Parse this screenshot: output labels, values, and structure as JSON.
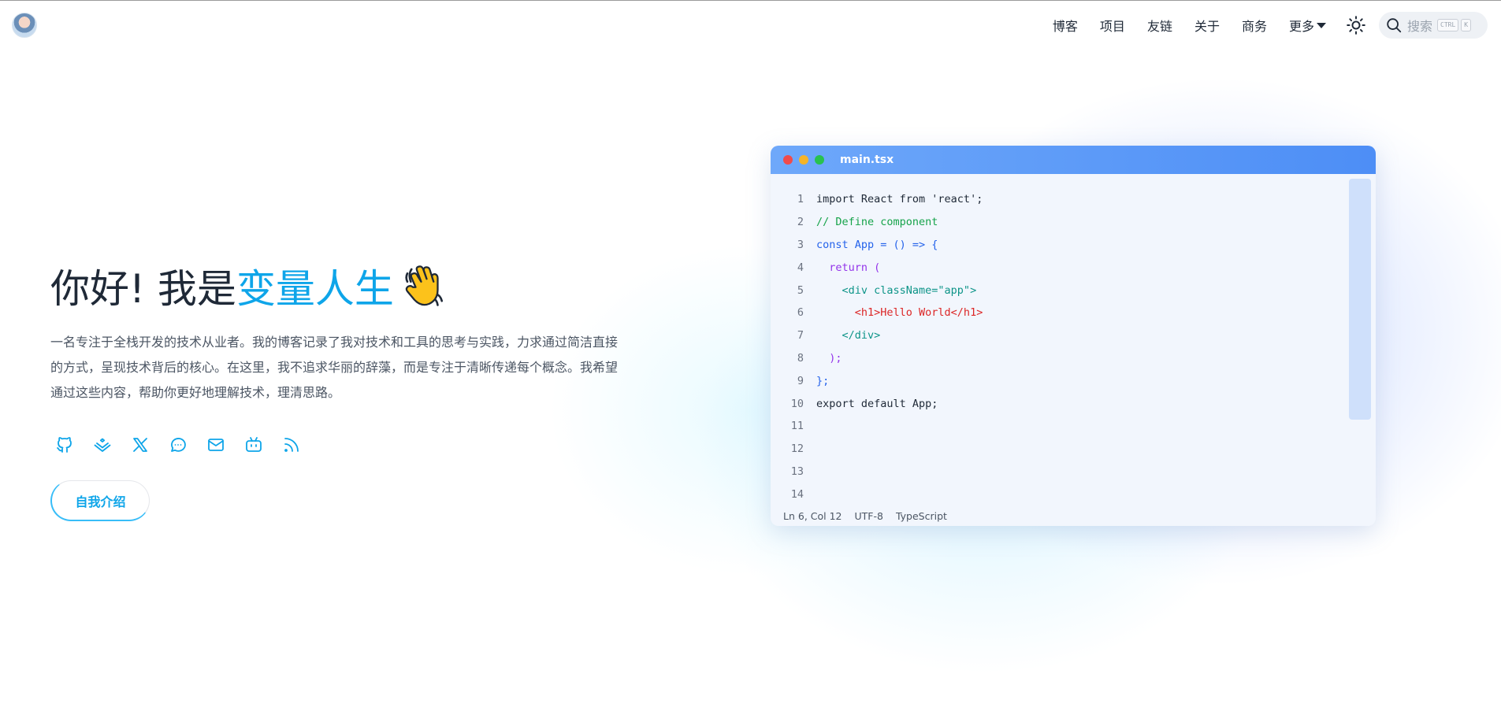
{
  "nav": {
    "items": [
      {
        "label": "博客"
      },
      {
        "label": "项目"
      },
      {
        "label": "友链"
      },
      {
        "label": "关于"
      },
      {
        "label": "商务"
      },
      {
        "label": "更多"
      }
    ],
    "more_icon": "caret-down-icon",
    "theme_icon": "sun-icon"
  },
  "search": {
    "placeholder": "搜索",
    "shortcut_ctrl": "CTRL",
    "shortcut_key": "K",
    "icon": "search-icon"
  },
  "hero": {
    "greeting": "你好! 我是",
    "name": "变量人生",
    "emoji_icon": "waving-hand-icon",
    "description": "一名专注于全栈开发的技术从业者。我的博客记录了我对技术和工具的思考与实践，力求通过简洁直接的方式，呈现技术背后的核心。在这里，我不追求华丽的辞藻，而是专注于清晰传递每个概念。我希望通过这些内容，帮助你更好地理解技术，理清思路。",
    "intro_button": "自我介绍",
    "accent_color": "#0ea5e9"
  },
  "socials": [
    {
      "icon": "github-icon"
    },
    {
      "icon": "juejin-icon"
    },
    {
      "icon": "x-twitter-icon"
    },
    {
      "icon": "chat-bubble-icon"
    },
    {
      "icon": "mail-icon"
    },
    {
      "icon": "bilibili-icon"
    },
    {
      "icon": "rss-icon"
    }
  ],
  "code_window": {
    "filename": "main.tsx",
    "lines": [
      {
        "n": "1",
        "text": "import React from 'react';",
        "color": "#1f2937"
      },
      {
        "n": "2",
        "text": "// Define component",
        "color": "#16a34a"
      },
      {
        "n": "3",
        "text": "const App = () => {",
        "color": "#2563eb"
      },
      {
        "n": "4",
        "text": "  return (",
        "color": "#9333ea"
      },
      {
        "n": "5",
        "text": "    <div className=\"app\">",
        "color": "#0d9488"
      },
      {
        "n": "6",
        "text": "      <h1>Hello World</h1>",
        "color": "#dc2626"
      },
      {
        "n": "7",
        "text": "    </div>",
        "color": "#0d9488"
      },
      {
        "n": "8",
        "text": "  );",
        "color": "#9333ea"
      },
      {
        "n": "9",
        "text": "};",
        "color": "#2563eb"
      },
      {
        "n": "10",
        "text": "export default App;",
        "color": "#1f2937"
      },
      {
        "n": "11",
        "text": "",
        "color": "#1f2937"
      },
      {
        "n": "12",
        "text": "",
        "color": "#1f2937"
      },
      {
        "n": "13",
        "text": "",
        "color": "#1f2937"
      },
      {
        "n": "14",
        "text": "",
        "color": "#1f2937"
      }
    ],
    "status": {
      "position": "Ln 6, Col 12",
      "encoding": "UTF-8",
      "language": "TypeScript"
    }
  }
}
